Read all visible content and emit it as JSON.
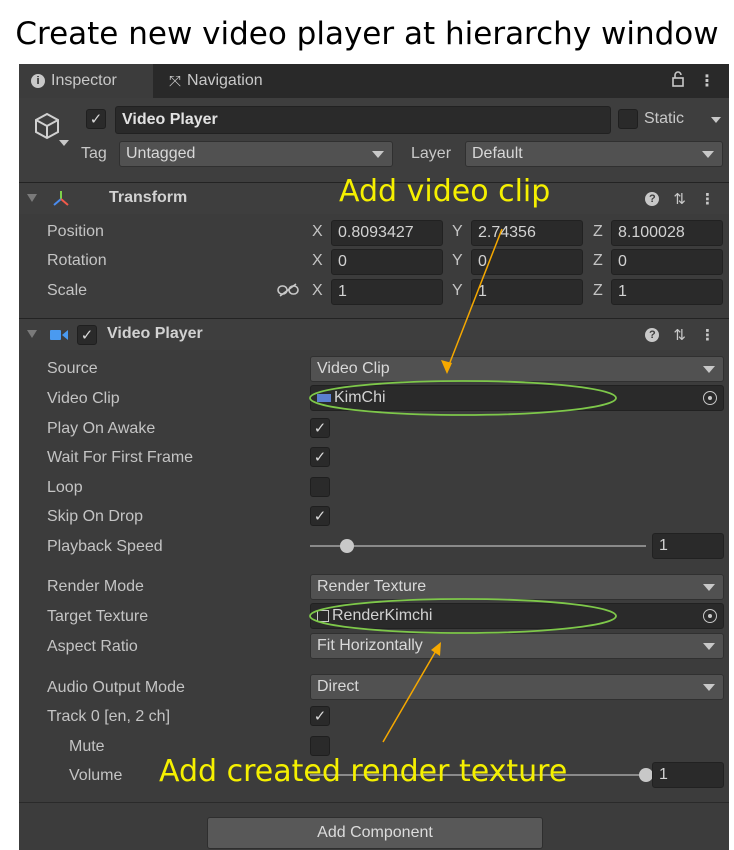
{
  "caption": "Create new video player at hierarchy window",
  "tabs": {
    "inspector": {
      "label": "Inspector",
      "icon": "info-icon"
    },
    "navigation": {
      "label": "Navigation",
      "icon": "navigation-icon"
    }
  },
  "header": {
    "object_name": "Video Player",
    "active_checked": true,
    "static_label": "Static",
    "static_checked": false,
    "tag_label": "Tag",
    "tag_value": "Untagged",
    "layer_label": "Layer",
    "layer_value": "Default"
  },
  "transform": {
    "title": "Transform",
    "position": {
      "label": "Position",
      "x": "0.8093427",
      "y": "2.74356",
      "z": "8.100028"
    },
    "rotation": {
      "label": "Rotation",
      "x": "0",
      "y": "0",
      "z": "0"
    },
    "scale": {
      "label": "Scale",
      "x": "1",
      "y": "1",
      "z": "1"
    },
    "axis_x": "X",
    "axis_y": "Y",
    "axis_z": "Z"
  },
  "video_player": {
    "title": "Video Player",
    "enabled": true,
    "source": {
      "label": "Source",
      "value": "Video Clip"
    },
    "video_clip": {
      "label": "Video Clip",
      "value": "KimChi"
    },
    "play_on_awake": {
      "label": "Play On Awake",
      "checked": true
    },
    "wait_first_frame": {
      "label": "Wait For First Frame",
      "checked": true
    },
    "loop": {
      "label": "Loop",
      "checked": false
    },
    "skip_on_drop": {
      "label": "Skip On Drop",
      "checked": true
    },
    "playback_speed": {
      "label": "Playback Speed",
      "value": "1",
      "level": 0.11
    },
    "render_mode": {
      "label": "Render Mode",
      "value": "Render Texture"
    },
    "target_texture": {
      "label": "Target Texture",
      "value": "RenderKimchi"
    },
    "aspect_ratio": {
      "label": "Aspect Ratio",
      "value": "Fit Horizontally"
    },
    "audio_output_mode": {
      "label": "Audio Output Mode",
      "value": "Direct"
    },
    "track0": {
      "label": "Track 0 [en, 2 ch]",
      "checked": true
    },
    "mute": {
      "label": "Mute",
      "checked": false
    },
    "volume": {
      "label": "Volume",
      "value": "1",
      "level": 1.0
    }
  },
  "add_component": "Add Component",
  "annotations": {
    "add_clip": "Add video clip",
    "add_texture": "Add created render texture"
  },
  "colors": {
    "annotation_text": "#f5f000",
    "arrow": "#f5a800",
    "ellipse": "#7ec84a",
    "panel_bg": "#3c3c3c"
  }
}
